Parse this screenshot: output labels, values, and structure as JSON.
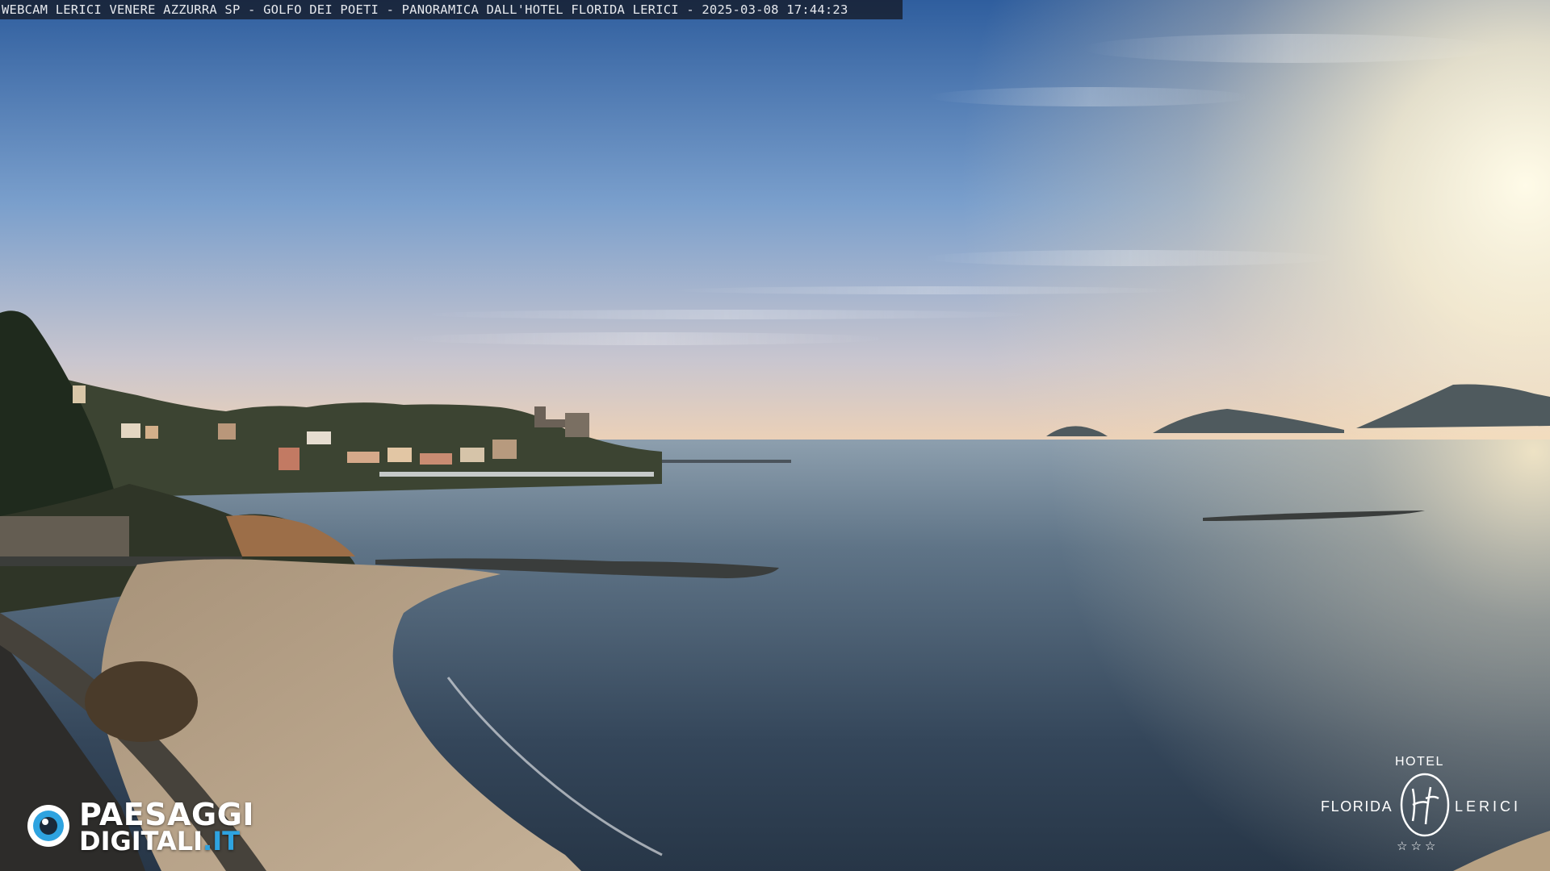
{
  "caption": {
    "text": "WEBCAM LERICI VENERE AZZURRA SP - GOLFO DEI POETI - PANORAMICA DALL'HOTEL FLORIDA LERICI - 2025-03-08 17:44:23"
  },
  "logos": {
    "paesaggi": {
      "line1": "PAESAGGI",
      "line2_main": "DIGITALI",
      "line2_tld": ".IT",
      "accent_color": "#2ea3e0"
    },
    "hotel": {
      "hotel_word": "HOTEL",
      "florida_word": "FLORIDA",
      "lerici_word": "LERICI",
      "monogram_letters": "HF",
      "stars": "☆☆☆"
    }
  },
  "scene": {
    "description_colors": {
      "sky_top": "#3d6aa8",
      "sky_mid": "#8fb0d6",
      "sky_horizon": "#f2d7b8",
      "sun_glow": "#fff6dc",
      "sea_dark": "#2c3a4a",
      "sea_light": "#93a7b5",
      "sand": "#b8a48a",
      "land_dark": "#1f2a1d"
    }
  }
}
